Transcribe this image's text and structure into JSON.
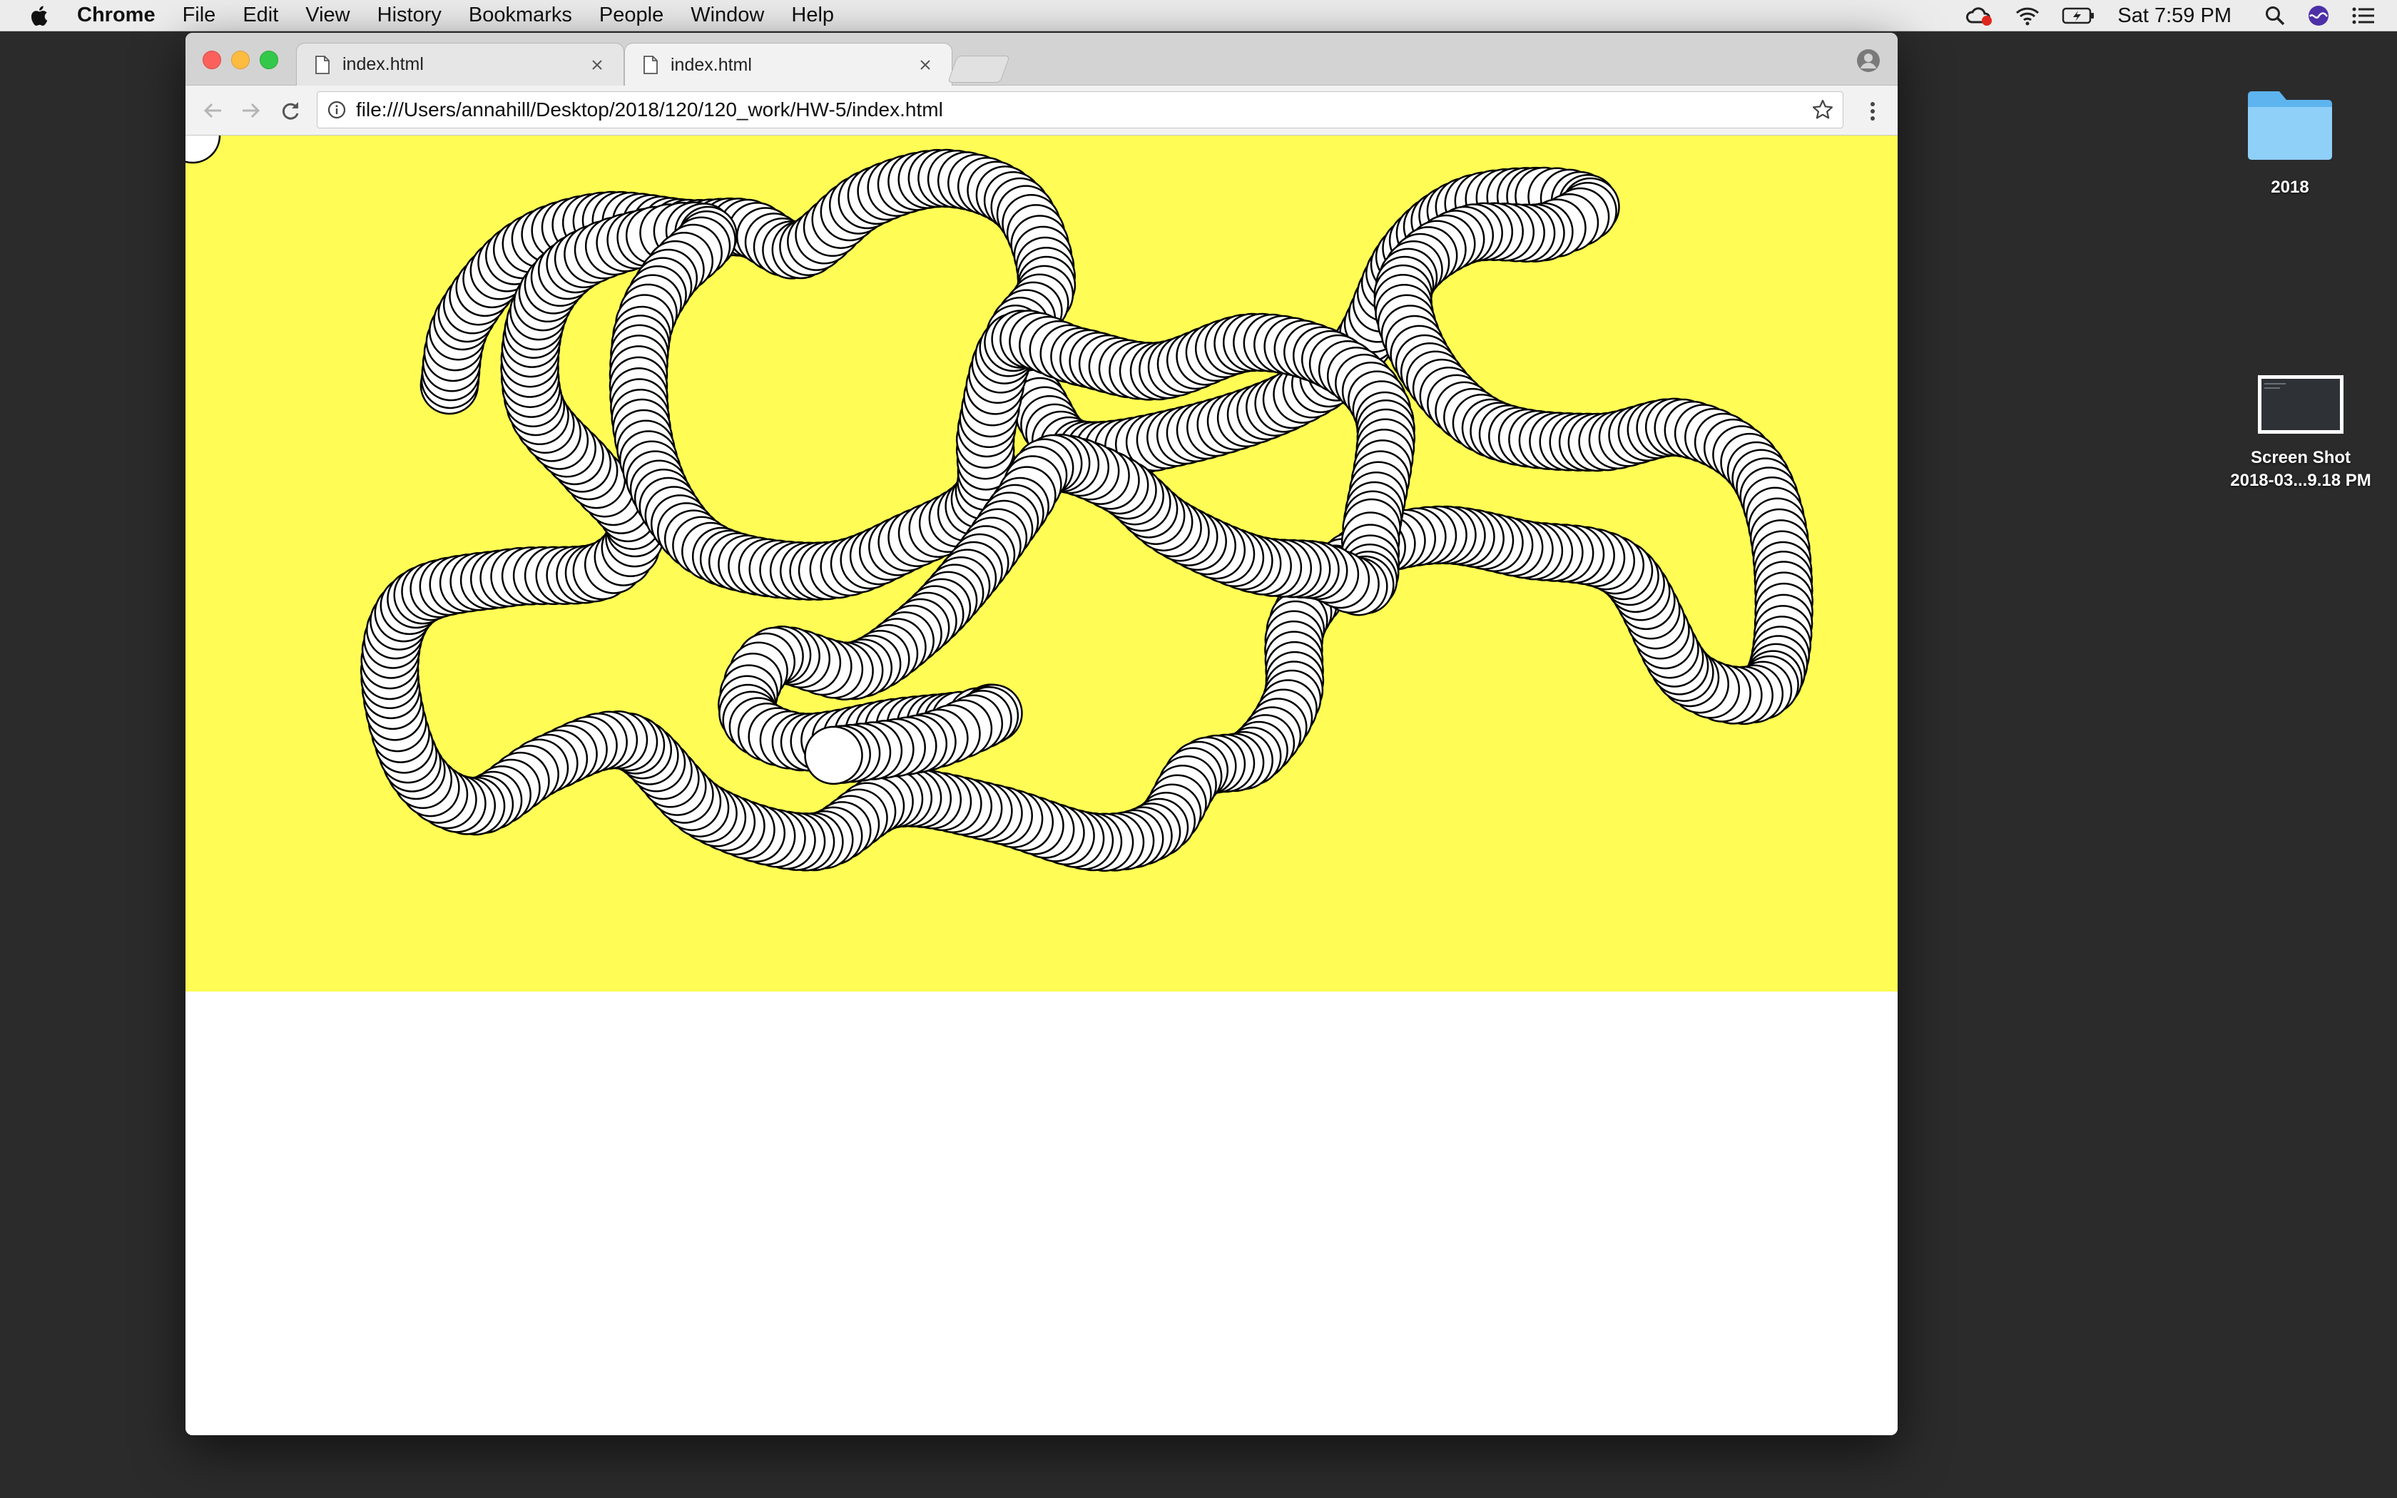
{
  "menubar": {
    "app_name": "Chrome",
    "items": [
      "File",
      "Edit",
      "View",
      "History",
      "Bookmarks",
      "People",
      "Window",
      "Help"
    ],
    "clock": "Sat 7:59 PM"
  },
  "desktop": {
    "folder_label": "2018",
    "screenshot_label_line1": "Screen Shot",
    "screenshot_label_line2": "2018-03...9.18 PM"
  },
  "browser": {
    "tabs": [
      {
        "title": "index.html",
        "active": false
      },
      {
        "title": "index.html",
        "active": true
      }
    ],
    "url": "file:///Users/annahill/Desktop/2018/120/120_work/HW-5/index.html"
  },
  "sketch": {
    "background_color": "#fffd55",
    "circle_fill": "#ffffff",
    "circle_stroke": "#000000"
  }
}
